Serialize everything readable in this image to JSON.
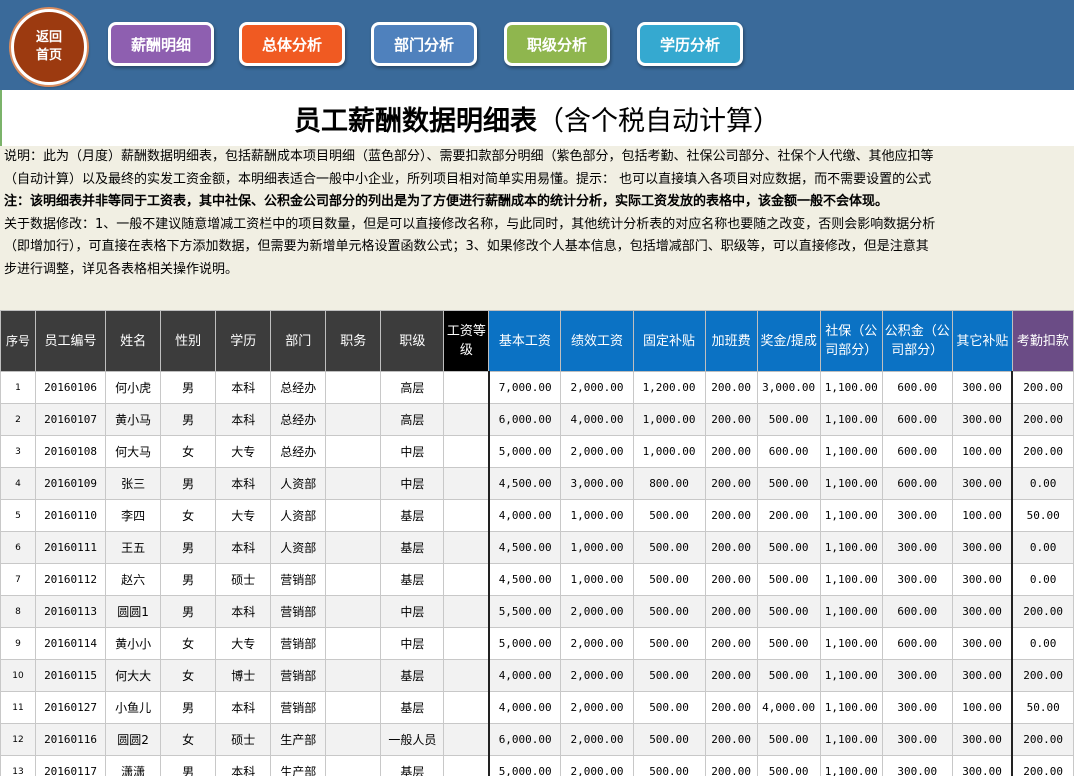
{
  "nav": {
    "home": "返回\n首页",
    "buttons": [
      {
        "label": "薪酬明细",
        "color": "#8e5fb0"
      },
      {
        "label": "总体分析",
        "color": "#f05a22"
      },
      {
        "label": "部门分析",
        "color": "#4f81bd"
      },
      {
        "label": "职级分析",
        "color": "#8fb64e"
      },
      {
        "label": "学历分析",
        "color": "#35a9d0"
      }
    ]
  },
  "title": {
    "main": "员工薪酬数据明细表",
    "sub": "（含个税自动计算）"
  },
  "notes": [
    "说明：此为（月度）薪酬数据明细表，包括薪酬成本项目明细（蓝色部分）、需要扣款部分明细（紫色部分，包括考勤、社保公司部分、社保个人代缴、其他应扣等",
    "（自动计算）以及最终的实发工资金额，本明细表适合一般中小企业，所列项目相对简单实用易懂。提示： 也可以直接填入各项目对应数据，而不需要设置的公式",
    "注：该明细表并非等同于工资表，其中社保、公积金公司部分的列出是为了方便进行薪酬成本的统计分析，实际工资发放的表格中，该金额一般不会体现。",
    "关于数据修改：1、一般不建议随意增减工资栏中的项目数量，但是可以直接修改名称，与此同时，其他统计分析表的对应名称也要随之改变，否则会影响数据分析",
    "（即增加行），可直接在表格下方添加数据，但需要为新增单元格设置函数公式；3、如果修改个人基本信息，包括增减部门、职级等，可以直接修改，但是注意其",
    "步进行调整，详见各表格相关操作说明。"
  ],
  "columns": [
    "序号",
    "员工编号",
    "姓名",
    "性别",
    "学历",
    "部门",
    "职务",
    "职级",
    "工资等级",
    "基本工资",
    "绩效工资",
    "固定补贴",
    "加班费",
    "奖金/提成",
    "社保（公司部分）",
    "公积金（公司部分）",
    "其它补贴",
    "考勤扣款"
  ],
  "rows": [
    [
      "1",
      "20160106",
      "何小虎",
      "男",
      "本科",
      "总经办",
      "",
      "高层",
      "",
      "7,000.00",
      "2,000.00",
      "1,200.00",
      "200.00",
      "3,000.00",
      "1,100.00",
      "600.00",
      "300.00",
      "200.00"
    ],
    [
      "2",
      "20160107",
      "黄小马",
      "男",
      "本科",
      "总经办",
      "",
      "高层",
      "",
      "6,000.00",
      "4,000.00",
      "1,000.00",
      "200.00",
      "500.00",
      "1,100.00",
      "600.00",
      "300.00",
      "200.00"
    ],
    [
      "3",
      "20160108",
      "何大马",
      "女",
      "大专",
      "总经办",
      "",
      "中层",
      "",
      "5,000.00",
      "2,000.00",
      "1,000.00",
      "200.00",
      "600.00",
      "1,100.00",
      "600.00",
      "100.00",
      "200.00"
    ],
    [
      "4",
      "20160109",
      "张三",
      "男",
      "本科",
      "人资部",
      "",
      "中层",
      "",
      "4,500.00",
      "3,000.00",
      "800.00",
      "200.00",
      "500.00",
      "1,100.00",
      "600.00",
      "300.00",
      "0.00"
    ],
    [
      "5",
      "20160110",
      "李四",
      "女",
      "大专",
      "人资部",
      "",
      "基层",
      "",
      "4,000.00",
      "1,000.00",
      "500.00",
      "200.00",
      "200.00",
      "1,100.00",
      "300.00",
      "100.00",
      "50.00"
    ],
    [
      "6",
      "20160111",
      "王五",
      "男",
      "本科",
      "人资部",
      "",
      "基层",
      "",
      "4,500.00",
      "1,000.00",
      "500.00",
      "200.00",
      "500.00",
      "1,100.00",
      "300.00",
      "300.00",
      "0.00"
    ],
    [
      "7",
      "20160112",
      "赵六",
      "男",
      "硕士",
      "营销部",
      "",
      "基层",
      "",
      "4,500.00",
      "1,000.00",
      "500.00",
      "200.00",
      "500.00",
      "1,100.00",
      "300.00",
      "300.00",
      "0.00"
    ],
    [
      "8",
      "20160113",
      "圆圆1",
      "男",
      "本科",
      "营销部",
      "",
      "中层",
      "",
      "5,500.00",
      "2,000.00",
      "500.00",
      "200.00",
      "500.00",
      "1,100.00",
      "600.00",
      "300.00",
      "200.00"
    ],
    [
      "9",
      "20160114",
      "黄小小",
      "女",
      "大专",
      "营销部",
      "",
      "中层",
      "",
      "5,000.00",
      "2,000.00",
      "500.00",
      "200.00",
      "500.00",
      "1,100.00",
      "600.00",
      "300.00",
      "0.00"
    ],
    [
      "10",
      "20160115",
      "何大大",
      "女",
      "博士",
      "营销部",
      "",
      "基层",
      "",
      "4,000.00",
      "2,000.00",
      "500.00",
      "200.00",
      "500.00",
      "1,100.00",
      "300.00",
      "300.00",
      "200.00"
    ],
    [
      "11",
      "20160127",
      "小鱼儿",
      "男",
      "本科",
      "营销部",
      "",
      "基层",
      "",
      "4,000.00",
      "2,000.00",
      "500.00",
      "200.00",
      "4,000.00",
      "1,100.00",
      "300.00",
      "100.00",
      "50.00"
    ],
    [
      "12",
      "20160116",
      "圆圆2",
      "女",
      "硕士",
      "生产部",
      "",
      "一般人员",
      "",
      "6,000.00",
      "2,000.00",
      "500.00",
      "200.00",
      "500.00",
      "1,100.00",
      "300.00",
      "300.00",
      "200.00"
    ],
    [
      "13",
      "20160117",
      "潇潇",
      "男",
      "本科",
      "生产部",
      "",
      "基层",
      "",
      "5,000.00",
      "2,000.00",
      "500.00",
      "200.00",
      "500.00",
      "1,100.00",
      "300.00",
      "300.00",
      "200.00"
    ]
  ]
}
